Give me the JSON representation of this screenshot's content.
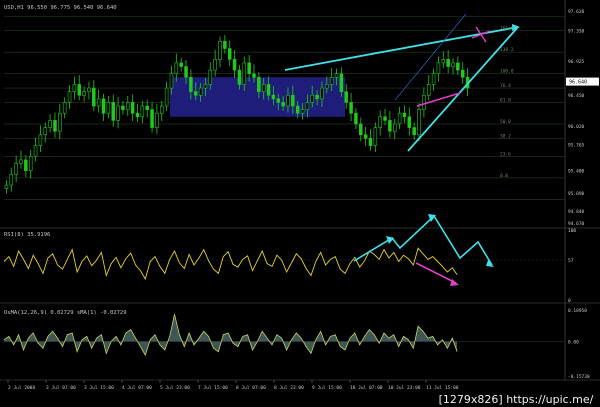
{
  "chart_data": [
    {
      "type": "candlestick",
      "panel": "price",
      "header": "USD,H1  96.550 96.775 96.540 96.640",
      "ylim": [
        94.63,
        97.72
      ],
      "y_ticks": [
        "97.620",
        "97.350",
        "96.925",
        "96.640",
        "96.450",
        "96.020",
        "95.765",
        "95.400",
        "95.090",
        "94.840",
        "94.670"
      ],
      "current_price": "96.640",
      "fib_labels": [
        "161.8",
        "138.2",
        "100.0",
        "76.4",
        "61.8",
        "50.0",
        "38.2",
        "23.6",
        "0.0"
      ],
      "series": [
        {
          "name": "close",
          "values": [
            95.2,
            95.35,
            95.5,
            95.55,
            95.4,
            95.6,
            95.75,
            95.9,
            96.0,
            96.1,
            95.95,
            96.2,
            96.35,
            96.5,
            96.6,
            96.45,
            96.5,
            96.55,
            96.3,
            96.4,
            96.2,
            96.35,
            96.1,
            96.3,
            96.25,
            96.35,
            96.2,
            96.15,
            96.3,
            96.25,
            96.0,
            96.2,
            96.3,
            96.55,
            96.75,
            96.9,
            96.85,
            96.7,
            96.5,
            96.45,
            96.55,
            96.6,
            96.8,
            96.95,
            97.2,
            97.1,
            96.95,
            96.8,
            96.6,
            96.9,
            96.75,
            96.7,
            96.5,
            96.6,
            96.45,
            96.4,
            96.35,
            96.3,
            96.45,
            96.3,
            96.2,
            96.25,
            96.35,
            96.45,
            96.4,
            96.55,
            96.6,
            96.7,
            96.75,
            96.5,
            96.35,
            96.2,
            96.05,
            95.9,
            95.85,
            95.75,
            96.0,
            96.15,
            96.1,
            95.95,
            96.05,
            96.2,
            96.15,
            96.0,
            95.9,
            96.25,
            96.45,
            96.6,
            96.75,
            96.9,
            96.95,
            96.85,
            96.9,
            96.8,
            96.7,
            96.55
          ]
        }
      ]
    },
    {
      "type": "line",
      "panel": "rsi",
      "header": "RSI(8) 35.9196",
      "ylim": [
        0,
        100
      ],
      "y_ticks": [
        "100",
        "57",
        "0"
      ],
      "series": [
        {
          "name": "RSI(8)",
          "values": [
            55,
            62,
            48,
            70,
            58,
            45,
            64,
            52,
            38,
            60,
            66,
            50,
            44,
            58,
            72,
            40,
            55,
            63,
            49,
            57,
            68,
            35,
            52,
            61,
            46,
            59,
            67,
            50,
            42,
            30,
            55,
            62,
            48,
            38,
            58,
            70,
            53,
            45,
            65,
            50,
            60,
            72,
            56,
            44,
            38,
            62,
            69,
            51,
            47,
            58,
            63,
            42,
            56,
            70,
            52,
            48,
            64,
            57,
            40,
            53,
            66,
            59,
            45,
            35,
            55,
            68,
            50,
            58,
            62,
            44,
            38,
            52,
            61,
            47,
            56,
            70,
            65,
            58,
            72,
            60,
            68,
            55,
            64,
            59,
            50,
            74,
            66,
            58,
            62,
            55,
            48,
            40,
            46,
            36
          ]
        }
      ]
    },
    {
      "type": "area",
      "panel": "osma",
      "header": "OsMA(12,26,9) 0.02729  sMA(1) -0.02729",
      "y_ticks": [
        "0.18950",
        "0.00",
        "-0.15730"
      ],
      "series": [
        {
          "name": "OsMA",
          "values": [
            0.01,
            0.03,
            -0.02,
            0.04,
            -0.05,
            0.02,
            0.05,
            -0.01,
            -0.04,
            0.03,
            0.06,
            0.02,
            -0.03,
            0.04,
            0.05,
            -0.06,
            0.01,
            0.03,
            -0.04,
            0.02,
            0.04,
            -0.07,
            0.0,
            0.03,
            -0.02,
            0.05,
            0.07,
            0.02,
            -0.03,
            -0.08,
            0.01,
            0.04,
            -0.02,
            -0.05,
            0.03,
            0.16,
            0.04,
            -0.03,
            0.05,
            -0.02,
            0.02,
            0.06,
            0.03,
            -0.04,
            -0.06,
            0.04,
            0.05,
            -0.01,
            -0.03,
            0.03,
            0.04,
            -0.05,
            0.0,
            0.06,
            0.02,
            -0.02,
            0.04,
            0.02,
            -0.05,
            0.01,
            0.05,
            0.02,
            -0.03,
            -0.07,
            0.01,
            0.06,
            -0.02,
            0.03,
            0.04,
            -0.03,
            -0.05,
            0.02,
            0.05,
            -0.02,
            0.03,
            0.07,
            0.04,
            -0.01,
            0.05,
            0.02,
            0.04,
            -0.03,
            0.03,
            0.01,
            -0.04,
            0.09,
            0.06,
            0.02,
            0.03,
            -0.02,
            0.01,
            -0.04,
            0.02,
            -0.06
          ]
        }
      ]
    }
  ],
  "x_ticks": [
    "2 Jul 2008",
    "3 Jul 07:00",
    "3 Jul 15:00",
    "4 Jul 07:00",
    "5 Jul 23:00",
    "7 Jul 15:00",
    "8 Jul 07:00",
    "8 Jul 23:00",
    "9 Jul 15:00",
    "10 Jul 07:00",
    "10 Jul 23:00",
    "11 Jul 15:00"
  ],
  "watermark": "[1279x826] https://upic.me/",
  "colors": {
    "background": "#000000",
    "candle": "#22c81e",
    "rsi_line": "#e8d32a",
    "osma_line": "#c8d85a",
    "osma_fill": "#4e6b6a",
    "trend_line": "#40e0e8",
    "divergence": "#e040c8",
    "zone": "#1e1e7a",
    "grid": "#3c5a3c",
    "axis_text": "#c8c8c8"
  }
}
